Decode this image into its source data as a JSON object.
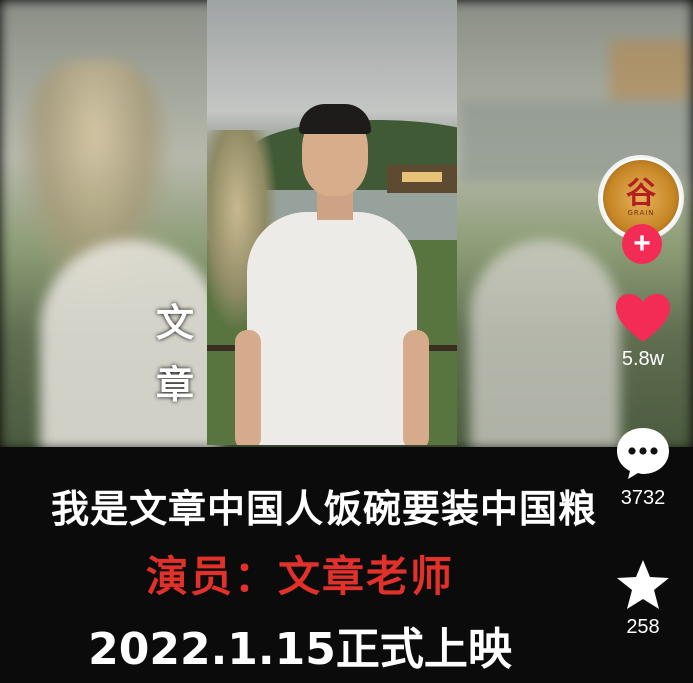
{
  "video": {
    "vertical_name": [
      "文",
      "章"
    ],
    "caption_line1": "我是文章中国人饭碗要装中国粮",
    "caption_line2": "演员：文章老师",
    "caption_line3": "2022.1.15正式上映"
  },
  "author": {
    "avatar_logo_char": "谷",
    "avatar_logo_sub": "GRAIN"
  },
  "actions": {
    "follow_label": "+",
    "likes": "5.8w",
    "comments": "3732",
    "favorites": "258"
  },
  "colors": {
    "follow_accent": "#f22c55",
    "like_heart": "#f22c55",
    "caption_highlight": "#e2312b"
  }
}
